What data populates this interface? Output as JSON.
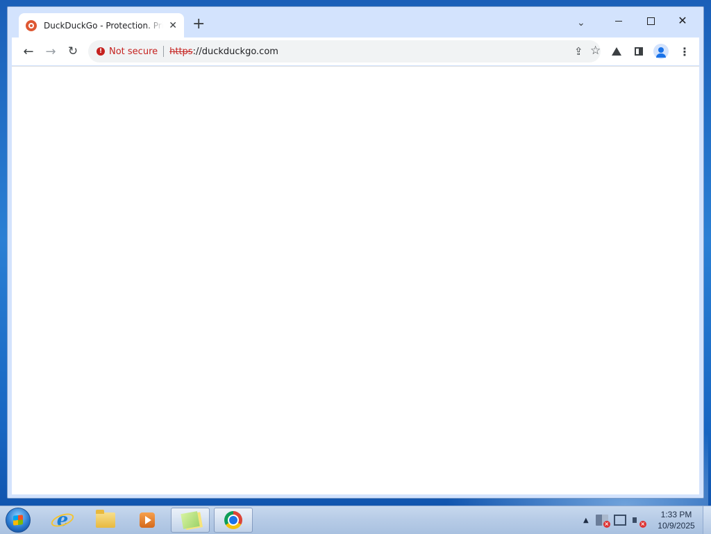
{
  "browser": {
    "tab": {
      "title": "DuckDuckGo - Protection. Privacy. Peace of mind.",
      "close_glyph": "✕",
      "favicon": "duckduckgo-icon"
    },
    "new_tab_glyph": "+",
    "tab_search_glyph": "⌄",
    "window_controls": {
      "close_glyph": "✕"
    },
    "nav": {
      "back_glyph": "←",
      "forward_glyph": "→",
      "reload_glyph": "↻"
    },
    "omnibox": {
      "security_label": "Not secure",
      "warning_glyph": "!",
      "url_scheme": "https",
      "url_rest": "://duckduckgo.com",
      "share_glyph": "⇪",
      "bookmark_glyph": "☆"
    },
    "menu_glyph": "⋮",
    "colors": {
      "tabstrip": "#d3e3fd",
      "not_secure": "#c5221f",
      "omnibox_bg": "#f1f3f4"
    }
  },
  "taskbar": {
    "apps": [
      {
        "name": "internet-explorer",
        "icon": "ie-icon"
      },
      {
        "name": "windows-explorer",
        "icon": "folder-icon"
      },
      {
        "name": "media-player",
        "icon": "media-player-icon"
      },
      {
        "name": "sticky-notes",
        "icon": "sticky-notes-icon",
        "active": true
      },
      {
        "name": "chrome",
        "icon": "chrome-icon",
        "active": true
      }
    ],
    "tray": {
      "expand_glyph": "▲"
    },
    "clock": {
      "time": "1:33 PM",
      "date": "10/9/2025"
    }
  }
}
